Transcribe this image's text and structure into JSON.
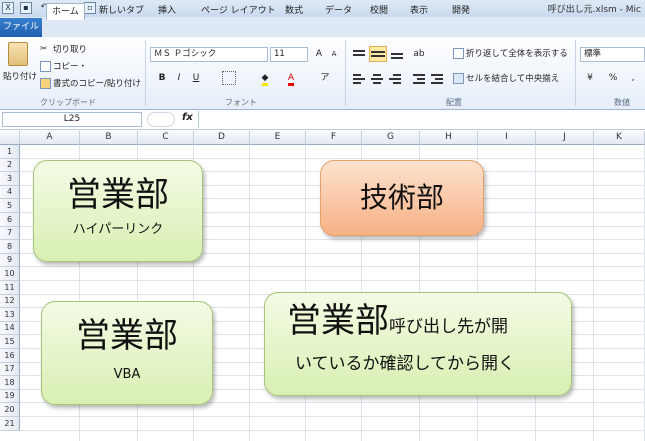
{
  "window": {
    "title": "呼び出し元.xlsm - Mic"
  },
  "tabs": [
    "ファイル",
    "ホーム",
    "新しいタブ",
    "挿入",
    "ページ レイアウト",
    "数式",
    "データ",
    "校閲",
    "表示",
    "開発"
  ],
  "clipboard": {
    "paste": "貼り付け",
    "cut": "切り取り",
    "copy": "コピー・",
    "format_painter": "書式のコピー/貼り付け",
    "label": "クリップボード"
  },
  "font": {
    "name": "ＭＳ Ｐゴシック",
    "size": "11",
    "label": "フォント",
    "bold": "B",
    "italic": "I",
    "underline": "U"
  },
  "alignment": {
    "wrap": "折り返して全体を表示する",
    "merge": "セルを結合して中央揃え",
    "label": "配置"
  },
  "number": {
    "format": "標準",
    "percent": "%",
    "label": "数値"
  },
  "formula_bar": {
    "name_box": "L25",
    "fx": "fx"
  },
  "columns": [
    "A",
    "B",
    "C",
    "D",
    "E",
    "F",
    "G",
    "H",
    "I",
    "J",
    "K"
  ],
  "rows": [
    "1",
    "2",
    "3",
    "4",
    "5",
    "6",
    "7",
    "8",
    "9",
    "10",
    "11",
    "12",
    "13",
    "14",
    "15",
    "16",
    "17",
    "18",
    "19",
    "20",
    "21"
  ],
  "shapes": {
    "s1": {
      "title": "営業部",
      "subtitle": "ハイパーリンク"
    },
    "s2": {
      "title": "技術部"
    },
    "s3": {
      "title": "営業部",
      "subtitle": "VBA"
    },
    "s4": {
      "title": "営業部",
      "title_small": "呼び出し先が開",
      "line2": "いているか確認してから開く"
    }
  },
  "colors": {
    "green_fill": "#d8efb2",
    "orange_fill": "#f7b184",
    "file_tab": "#1f5fae"
  }
}
